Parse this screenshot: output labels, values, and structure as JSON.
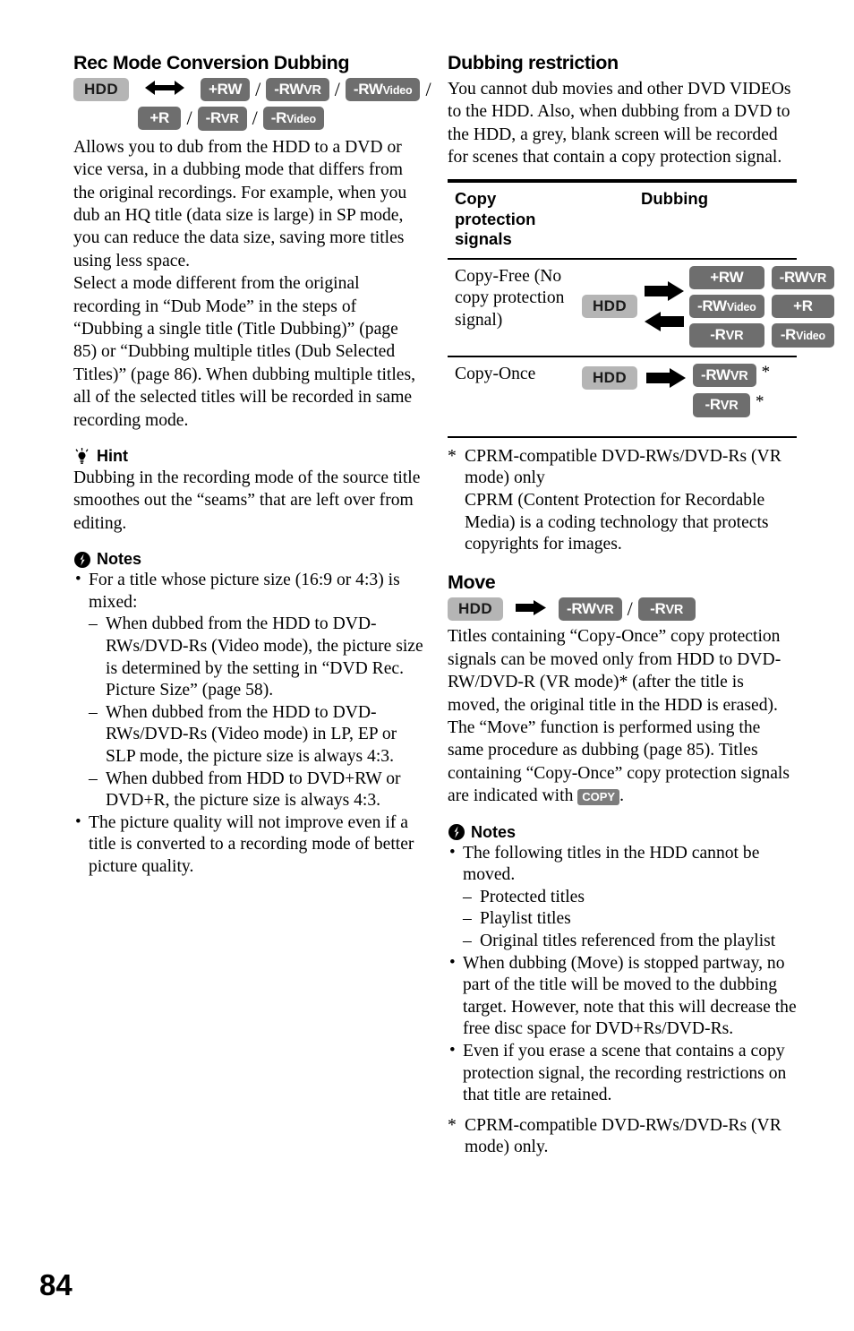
{
  "page_number": "84",
  "colors": {
    "chip_dark": "#6e6e6e",
    "chip_hdd": "#b5b5b5",
    "chip_copy": "#7d7d7d",
    "text": "#000000",
    "background": "#ffffff"
  },
  "left_column": {
    "heading": "Rec Mode Conversion Dubbing",
    "badge_row_1": {
      "hdd": "HDD",
      "items": [
        {
          "main": "+RW",
          "sub": ""
        },
        {
          "main": "-RW",
          "sub": "VR"
        },
        {
          "main": "-RW",
          "sub": "Video"
        }
      ],
      "separator": "/"
    },
    "badge_row_2": {
      "items": [
        {
          "main": "+R",
          "sub": ""
        },
        {
          "main": "-R",
          "sub": "VR"
        },
        {
          "main": "-R",
          "sub": "Video"
        }
      ],
      "separator": "/"
    },
    "paragraph_1": "Allows you to dub from the HDD to a DVD or vice versa, in a dubbing mode that differs from the original recordings. For example, when you dub an HQ title (data size is large) in SP mode, you can reduce the data size, saving more titles using less space.",
    "paragraph_2": "Select a mode different from the original recording in “Dub Mode” in the steps of “Dubbing a single title (Title Dubbing)” (page 85) or “Dubbing multiple titles (Dub Selected Titles)” (page 86). When dubbing multiple titles, all of the selected titles will be recorded in same recording mode.",
    "hint": {
      "label": "Hint",
      "icon": "lightbulb-icon",
      "text": "Dubbing in the recording mode of the source title smoothes out the “seams” that are left over from editing."
    },
    "notes": {
      "label": "Notes",
      "icon": "exclamation-circle-icon",
      "items": [
        {
          "text": "For a title whose picture size (16:9 or 4:3) is mixed:",
          "sub_items": [
            "When dubbed from the HDD to DVD-RWs/DVD-Rs (Video mode), the picture size is determined by the setting in “DVD Rec. Picture Size” (page 58).",
            "When dubbed from the HDD to DVD-RWs/DVD-Rs (Video mode) in LP, EP or SLP mode, the picture size is always 4:3.",
            "When dubbed from HDD to DVD+RW or DVD+R, the picture size is always 4:3."
          ]
        },
        {
          "text": "The picture quality will not improve even if a title is converted to a recording mode of better picture quality.",
          "sub_items": []
        }
      ]
    }
  },
  "right_column": {
    "restriction": {
      "heading": "Dubbing restriction",
      "paragraph": "You cannot dub movies and other DVD VIDEOs to the HDD. Also, when dubbing from a DVD to the HDD, a grey, blank screen will be recorded for scenes that contain a copy protection signal."
    },
    "table": {
      "header_col1": "Copy protection signals",
      "header_col2": "Dubbing",
      "rows": [
        {
          "label": "Copy-Free (No copy protection signal)",
          "source": "HDD",
          "direction": "bidirectional",
          "targets": [
            {
              "main": "+RW",
              "sub": "",
              "star": false
            },
            {
              "main": "-RW",
              "sub": "VR",
              "star": false
            },
            {
              "main": "-RW",
              "sub": "Video",
              "star": false
            },
            {
              "main": "+R",
              "sub": "",
              "star": false
            },
            {
              "main": "-R",
              "sub": "VR",
              "star": false
            },
            {
              "main": "-R",
              "sub": "Video",
              "star": false
            }
          ]
        },
        {
          "label": "Copy-Once",
          "source": "HDD",
          "direction": "right",
          "targets": [
            {
              "main": "-RW",
              "sub": "VR",
              "star": true
            },
            {
              "main": "-R",
              "sub": "VR",
              "star": true
            }
          ]
        }
      ]
    },
    "table_footnote": {
      "marker": "*",
      "line_1": "CPRM-compatible DVD-RWs/DVD-Rs (VR mode) only",
      "line_2": "CPRM (Content Protection for Recordable Media) is a coding technology that protects copyrights for images."
    },
    "move": {
      "heading": "Move",
      "badges": {
        "hdd": "HDD",
        "separator": "/",
        "items": [
          {
            "main": "-RW",
            "sub": "VR"
          },
          {
            "main": "-R",
            "sub": "VR"
          }
        ]
      },
      "paragraph_part_1": "Titles containing “Copy-Once” copy protection signals can be moved only from HDD to DVD-RW/DVD-R (VR mode)* (after the title is moved, the original title in the HDD is erased). The “Move” function is performed using the same procedure as dubbing (page 85). Titles containing “Copy-Once” copy protection signals are indicated with ",
      "copy_badge": "COPY",
      "paragraph_part_2": "."
    },
    "notes": {
      "label": "Notes",
      "icon": "exclamation-circle-icon",
      "items": [
        {
          "text": "The following titles in the HDD cannot be moved.",
          "sub_items": [
            "Protected titles",
            "Playlist titles",
            "Original titles referenced from the playlist"
          ]
        },
        {
          "text": "When dubbing (Move) is stopped partway, no part of the title will be moved to the dubbing target. However, note that this will decrease the free disc space for DVD+Rs/DVD-Rs.",
          "sub_items": []
        },
        {
          "text": "Even if you erase a scene that contains a copy protection signal, the recording restrictions on that title are retained.",
          "sub_items": []
        }
      ],
      "footnote": {
        "marker": "*",
        "text": "CPRM-compatible DVD-RWs/DVD-Rs (VR mode) only."
      }
    }
  }
}
